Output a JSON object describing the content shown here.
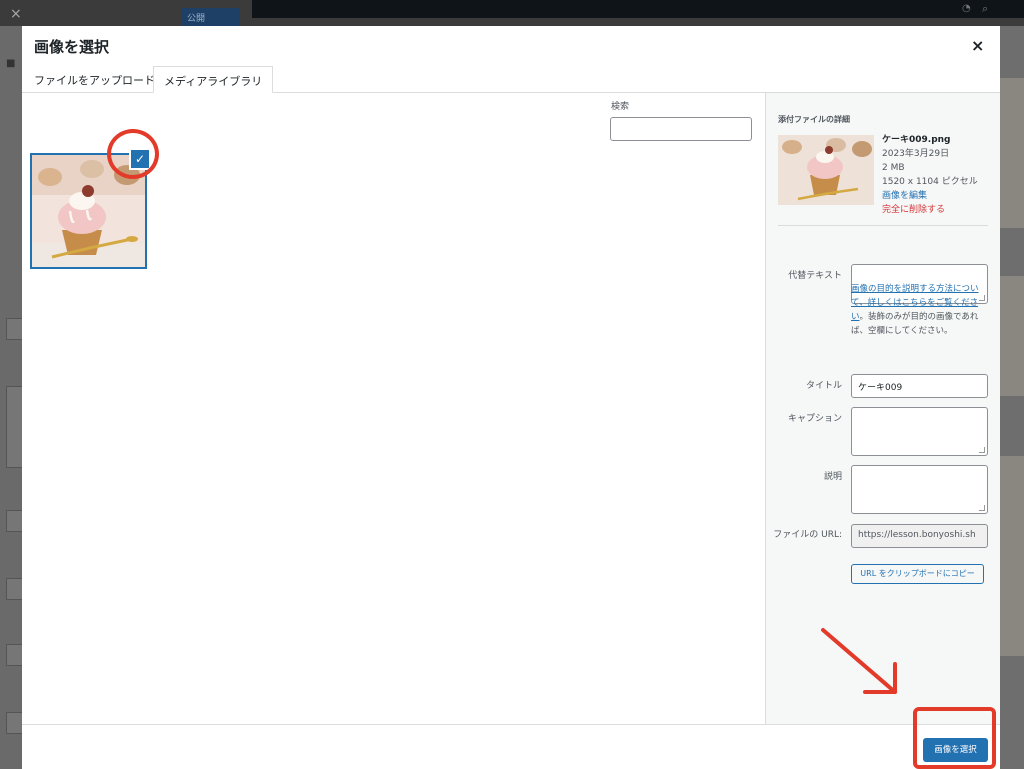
{
  "modal": {
    "title": "画像を選択",
    "close_symbol": "×",
    "tabs": [
      {
        "label": "ファイルをアップロード",
        "active": false
      },
      {
        "label": "メディアライブラリ",
        "active": true
      }
    ]
  },
  "search": {
    "label": "検索",
    "value": ""
  },
  "attachment": {
    "selected": true,
    "check_symbol": "✓"
  },
  "details": {
    "heading": "添付ファイルの詳細",
    "filename": "ケーキ009.png",
    "date": "2023年3月29日",
    "size": "2 MB",
    "dimensions": "1520 x 1104 ピクセル",
    "edit_link": "画像を編集",
    "delete_link": "完全に削除する"
  },
  "fields": {
    "alt_label": "代替テキスト",
    "alt_value": "",
    "alt_help_link": "画像の目的を説明する方法について、詳しくはこちらをご覧ください",
    "alt_help_text": "。装飾のみが目的の画像であれば、空欄にしてください。",
    "title_label": "タイトル",
    "title_value": "ケーキ009",
    "caption_label": "キャプション",
    "caption_value": "",
    "description_label": "説明",
    "description_value": "",
    "url_label": "ファイルの URL:",
    "url_value": "https://lesson.bonyoshi.sh",
    "copy_button": "URL をクリップボードにコピー"
  },
  "footer": {
    "select_button": "画像を選択"
  },
  "background": {
    "publish_label": "公開",
    "close_symbol": "×"
  },
  "colors": {
    "accent": "#2271b1",
    "danger": "#d63638",
    "annotation": "#e23b2a"
  }
}
